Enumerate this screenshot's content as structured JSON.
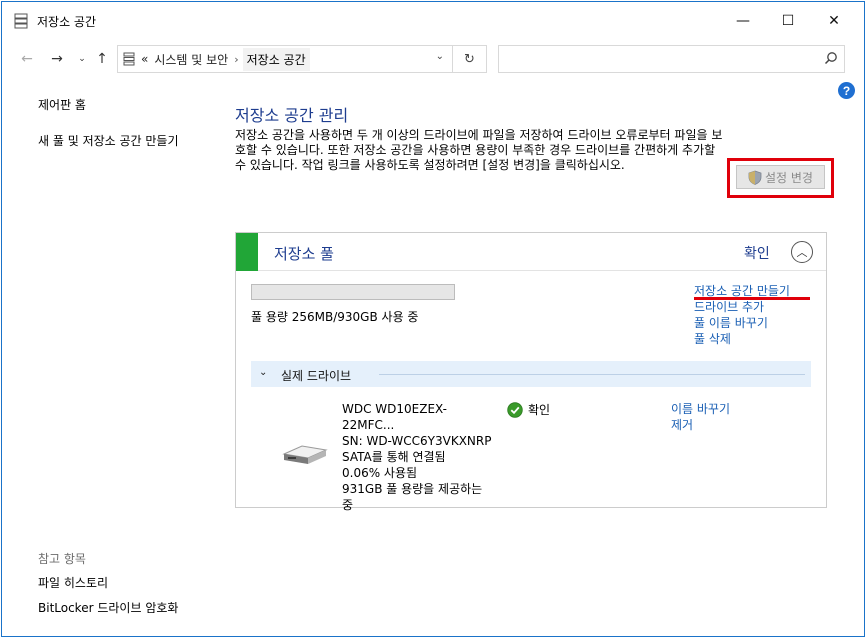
{
  "window": {
    "title": "저장소 공간",
    "minimize": "—",
    "maximize": "☐",
    "close": "✕"
  },
  "nav": {
    "back": "←",
    "forward": "→",
    "recent": "⌄",
    "up": "↑",
    "address": {
      "overflow": "«",
      "parent": "시스템 및 보안",
      "separator": "›",
      "current": "저장소 공간",
      "dropdown": "⌄",
      "refresh": "↻"
    },
    "search": {
      "placeholder": ""
    }
  },
  "help": {
    "label": "?"
  },
  "sidebar": {
    "home": "제어판 홈",
    "new_pool": "새 풀 및 저장소 공간 만들기",
    "see_also_heading": "참고 항목",
    "see_also": [
      "파일 히스토리",
      "BitLocker 드라이브 암호화"
    ]
  },
  "main": {
    "title": "저장소 공간 관리",
    "description": "저장소 공간을 사용하면 두 개 이상의 드라이브에 파일을 저장하여 드라이브 오류로부터 파일을 보호할 수 있습니다. 또한 저장소 공간을 사용하면 용량이 부족한 경우 드라이브를 간편하게 추가할 수 있습니다. 작업 링크를 사용하도록 설정하려면 [설정 변경]을 클릭하십시오.",
    "change_settings": "설정 변경"
  },
  "pool": {
    "title": "저장소 풀",
    "status": "확인",
    "collapse": "︿",
    "capacity_text": "풀 용량 256MB/930GB 사용 중",
    "capacity_used_fraction": 0.0003,
    "links": [
      "저장소 공간 만들기",
      "드라이브 추가",
      "풀 이름 바꾸기",
      "풀 삭제"
    ],
    "physical_heading": "실제 드라이브",
    "physical_chevron": "⌄",
    "drive": {
      "name": "WDC WD10EZEX-22MFC...",
      "serial": "SN: WD-WCC6Y3VKXNRP",
      "connection": "SATA를 통해 연결됨",
      "usage": "0.06% 사용됨",
      "provides": "931GB 풀 용량을 제공하는 중",
      "status": "확인",
      "links": [
        "이름 바꾸기",
        "제거"
      ]
    }
  },
  "colors": {
    "accent_green": "#21a637",
    "link_blue": "#1a5fb4",
    "heading_blue": "#1e3d8f",
    "highlight_red": "#e0000a"
  }
}
